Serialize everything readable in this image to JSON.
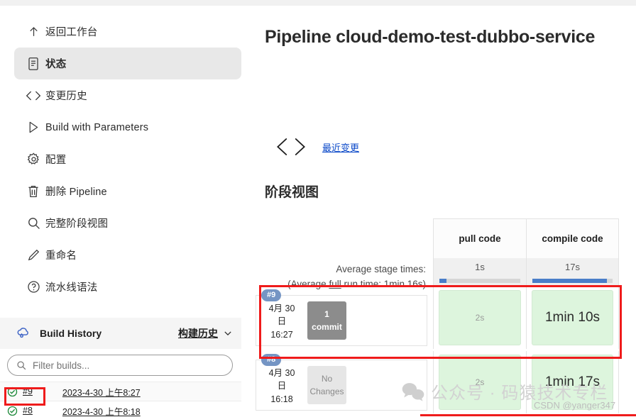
{
  "sidebar": {
    "nav_items": [
      {
        "label": "返回工作台",
        "icon": "arrow-up-icon",
        "active": false
      },
      {
        "label": "状态",
        "icon": "document-icon",
        "active": true
      },
      {
        "label": "变更历史",
        "icon": "code-brackets-icon",
        "active": false
      },
      {
        "label": "Build with Parameters",
        "icon": "play-icon",
        "active": false
      },
      {
        "label": "配置",
        "icon": "gear-icon",
        "active": false
      },
      {
        "label": "删除 Pipeline",
        "icon": "trash-icon",
        "active": false
      },
      {
        "label": "完整阶段视图",
        "icon": "search-icon",
        "active": false
      },
      {
        "label": "重命名",
        "icon": "pencil-icon",
        "active": false
      },
      {
        "label": "流水线语法",
        "icon": "question-circle-icon",
        "active": false
      }
    ],
    "build_history": {
      "title": "Build History",
      "link_label": "构建历史",
      "icon": "weather-cloud-icon",
      "chevron": "chevron-down-icon",
      "filter_placeholder": "Filter builds...",
      "filter_value": "",
      "filter_icon": "search-icon",
      "builds": [
        {
          "number": "#9",
          "timestamp": "2023-4-30 上午8:27",
          "status": "success",
          "highlighted": true
        },
        {
          "number": "#8",
          "timestamp": "2023-4-30 上午8:18",
          "status": "success",
          "highlighted": false
        }
      ]
    }
  },
  "main": {
    "page_title": "Pipeline cloud-demo-test-dubbo-service",
    "changes": {
      "icon": "code-brackets-icon",
      "link_label": "最近变更"
    },
    "stage_view": {
      "section_title": "阶段视图",
      "average_label_line1": "Average stage times:",
      "average_label_line2_pre": "(Average ",
      "average_label_line2_underline": "full",
      "average_label_line2_post": " run time: 1min 16s)",
      "columns": [
        {
          "name": "pull code",
          "average": "1s",
          "bar_percent": 9
        },
        {
          "name": "compile code",
          "average": "17s",
          "bar_percent": 93
        }
      ],
      "rows": [
        {
          "build": "#9",
          "date": "4月 30",
          "date_suffix": "日",
          "time": "16:27",
          "commit_count": "1",
          "commit_label": "commit",
          "has_changes": true,
          "cells": [
            {
              "duration": "2s",
              "emphasis": "small"
            },
            {
              "duration": "1min 10s",
              "emphasis": "big"
            }
          ]
        },
        {
          "build": "#8",
          "date": "4月 30",
          "date_suffix": "日",
          "time": "16:18",
          "commit_count": "No",
          "commit_label": "Changes",
          "has_changes": false,
          "cells": [
            {
              "duration": "2s",
              "emphasis": "small"
            },
            {
              "duration": "1min 17s",
              "emphasis": "big"
            }
          ]
        }
      ]
    }
  },
  "watermark": {
    "icon": "wechat-icon",
    "text": "公众号 · 码猿技术专栏",
    "credit": "CSDN @yanger347"
  },
  "colors": {
    "accent_blue": "#4a7ec9",
    "link_blue": "#0b49c9",
    "highlight_red": "#ef1b1b",
    "stage_green": "#ddf5dd",
    "badge_blue": "#7595c4",
    "success_green": "#1f8a3b"
  }
}
